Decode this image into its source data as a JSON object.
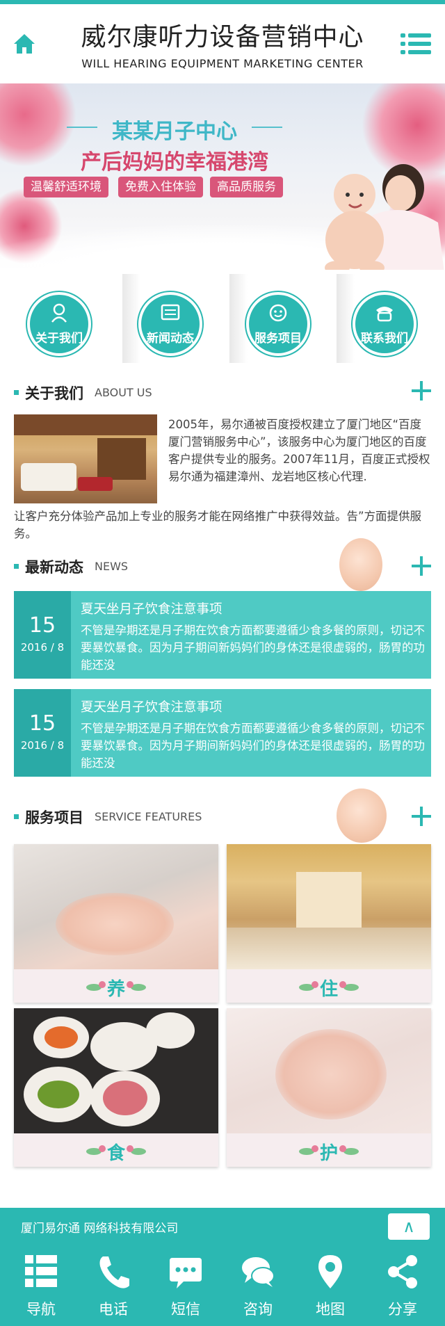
{
  "header": {
    "title": "威尔康听力设备营销中心",
    "subtitle": "WILL HEARING EQUIPMENT MARKETING CENTER"
  },
  "banner": {
    "headline": "某某月子中心",
    "subheadline": "产后妈妈的幸福港湾",
    "tags": [
      "温馨舒适环境",
      "免费入住体验",
      "高品质服务"
    ],
    "slide_count": 3
  },
  "nav": [
    {
      "label": "关于我们",
      "icon": "person-icon"
    },
    {
      "label": "新闻动态",
      "icon": "newspaper-icon"
    },
    {
      "label": "服务项目",
      "icon": "service-icon"
    },
    {
      "label": "联系我们",
      "icon": "phone-icon"
    }
  ],
  "about": {
    "title": "关于我们",
    "title_en": "ABOUT US",
    "text": "2005年，易尔通被百度授权建立了厦门地区“百度厦门营销服务中心”，该服务中心为厦门地区的百度客户提供专业的服务。2007年11月，百度正式授权易尔通为福建漳州、龙岩地区核心代理.",
    "text2": "让客户充分体验产品加上专业的服务才能在网络推广中获得效益。告”方面提供服务。"
  },
  "news": {
    "title": "最新动态",
    "title_en": "NEWS",
    "items": [
      {
        "day": "15",
        "year_month": "2016 / 8",
        "title": "夏天坐月子饮食注意事项",
        "body": "不管是孕期还是月子期在饮食方面都要遵循少食多餐的原则，切记不要暴饮暴食。因为月子期间新妈妈们的身体还是很虚弱的，肠胃的功能还没"
      },
      {
        "day": "15",
        "year_month": "2016 / 8",
        "title": "夏天坐月子饮食注意事项",
        "body": "不管是孕期还是月子期在饮食方面都要遵循少食多餐的原则，切记不要暴饮暴食。因为月子期间新妈妈们的身体还是很虚弱的，肠胃的功能还没"
      }
    ]
  },
  "services": {
    "title": "服务项目",
    "title_en": "SERVICE FEATURES",
    "items": [
      {
        "label": "养"
      },
      {
        "label": "住"
      },
      {
        "label": "食"
      },
      {
        "label": "护"
      }
    ]
  },
  "footer": {
    "company": "厦门易尔通 网络科技有限公司",
    "top_button": "∧"
  },
  "bottom_nav": [
    {
      "label": "导航",
      "icon": "grid-menu-icon"
    },
    {
      "label": "电话",
      "icon": "phone-icon"
    },
    {
      "label": "短信",
      "icon": "message-icon"
    },
    {
      "label": "咨询",
      "icon": "chat-icon"
    },
    {
      "label": "地图",
      "icon": "map-pin-icon"
    },
    {
      "label": "分享",
      "icon": "share-icon"
    }
  ],
  "colors": {
    "accent": "#2bb8b2",
    "news_bg": "#4fcac4",
    "banner_pink": "#d9567a"
  }
}
